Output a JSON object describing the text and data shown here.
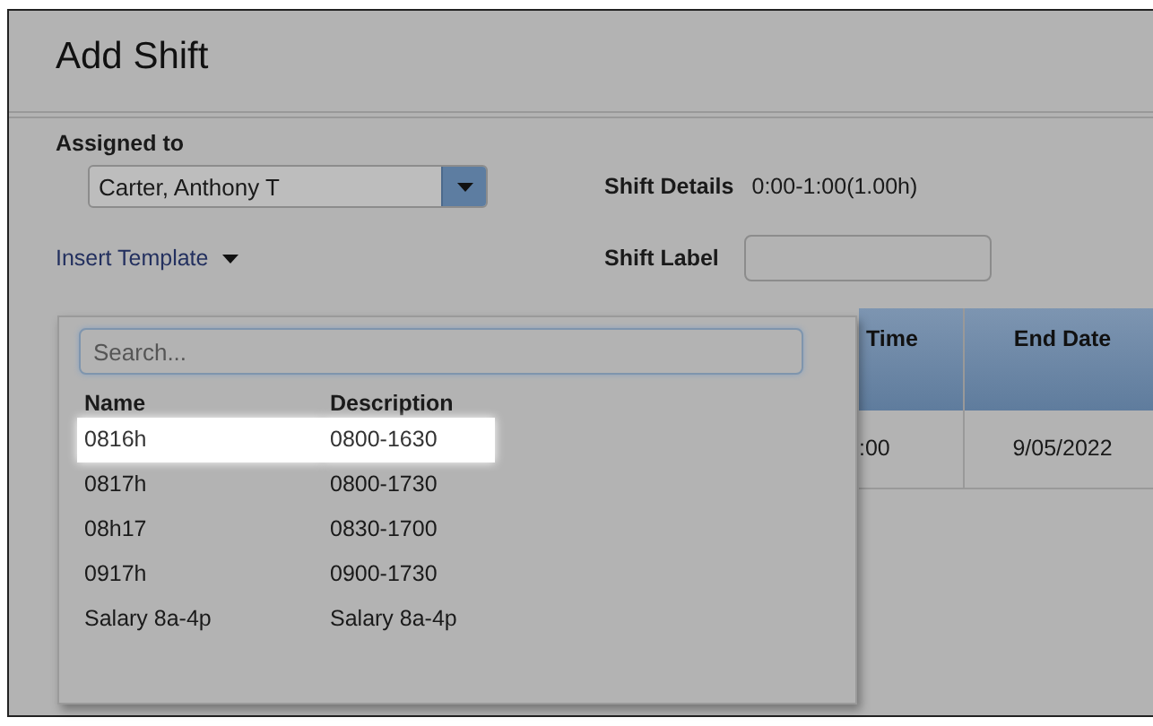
{
  "dialog": {
    "title": "Add Shift"
  },
  "assigned_to": {
    "label": "Assigned to",
    "value": "Carter, Anthony T"
  },
  "shift_details": {
    "label": "Shift Details",
    "value": "0:00-1:00(1.00h)"
  },
  "insert_template": {
    "label": "Insert Template",
    "expanded": true
  },
  "shift_label": {
    "label": "Shift Label"
  },
  "table": {
    "columns": [
      "Time",
      "End Date"
    ],
    "rows": [
      [
        ":00",
        "9/05/2022"
      ]
    ]
  },
  "template_popup": {
    "search": {
      "placeholder": "Search..."
    },
    "columns": [
      "Name",
      "Description"
    ],
    "items": [
      {
        "name": "0816h",
        "description": "0800-1630",
        "selected": true
      },
      {
        "name": "0817h",
        "description": "0800-1730",
        "selected": false
      },
      {
        "name": "08h17",
        "description": "0830-1700",
        "selected": false
      },
      {
        "name": "0917h",
        "description": "0900-1730",
        "selected": false
      },
      {
        "name": "Salary 8a-4p",
        "description": "Salary 8a-4p",
        "selected": false
      }
    ]
  }
}
